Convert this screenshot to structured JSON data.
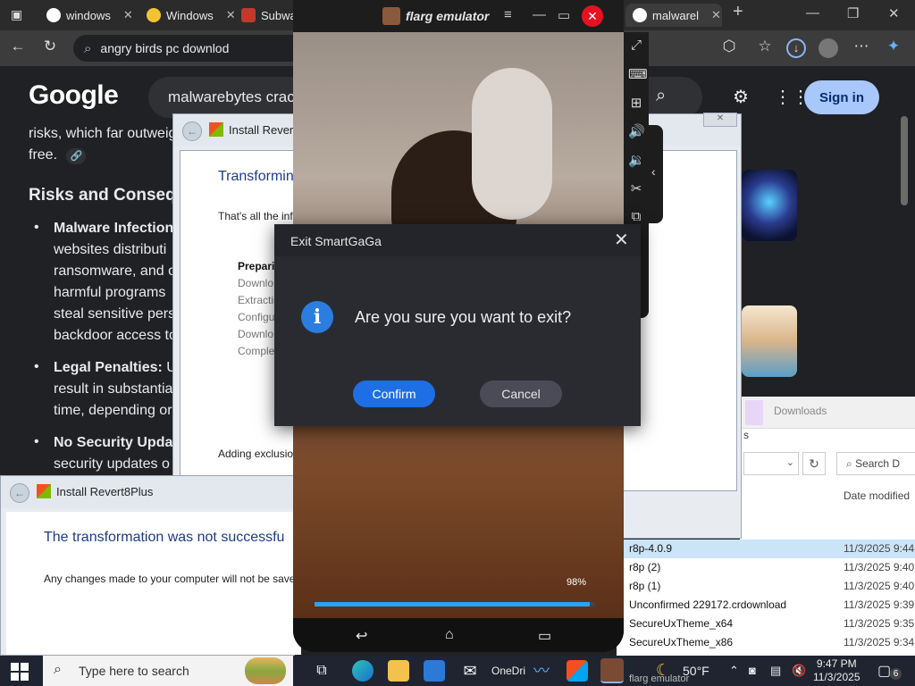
{
  "browser": {
    "tabs": [
      {
        "label": "windows"
      },
      {
        "label": "Windows"
      },
      {
        "label": "Subwa"
      },
      {
        "label": "malwarel"
      }
    ],
    "address": "angry birds pc downlod"
  },
  "google": {
    "logo": "Google",
    "query": "malwarebytes crack",
    "signin": "Sign in",
    "lines": {
      "l1": "risks, which far outweig",
      "l2": "free.",
      "heading": "Risks and Conseq",
      "b1_title": "Malware Infection:",
      "b1_l2": "websites distributi",
      "b1_l3": "ransomware, and o",
      "b1_l4": "harmful programs",
      "b1_l5": "steal sensitive pers",
      "b1_l6": "backdoor access to",
      "b2_title": "Legal Penalties:",
      "b2_title_rest": "Us",
      "b2_l2": "result in substantia",
      "b2_l3": "time, depending or",
      "b3_title": "No Security Updat",
      "b3_l2": "security updates o"
    }
  },
  "install_back": {
    "title": "Install Revert",
    "heading": "Transformin",
    "para": "That's all the inf",
    "steps": [
      "Preparir",
      "Downlo",
      "Extractir",
      "Configu",
      "Downlo",
      "Comple"
    ],
    "status": "Adding exclusio"
  },
  "install_front": {
    "title": "Install Revert8Plus",
    "heading": "The transformation was not successfu",
    "para": "Any changes made to your computer will not be save"
  },
  "emulator": {
    "name": "flarg emulator",
    "progress_label": "98%",
    "progress": 0.98
  },
  "dialog": {
    "title": "Exit SmartGaGa",
    "message": "Are you sure you want to exit?",
    "confirm": "Confirm",
    "cancel": "Cancel"
  },
  "downloads": {
    "title": "Downloads",
    "tab_suffix": "s",
    "search_placeholder": "Search D",
    "column": "Date modified",
    "files": [
      {
        "name": "r8p-4.0.9",
        "date": "11/3/2025 9:44"
      },
      {
        "name": "r8p (2)",
        "date": "11/3/2025 9:40"
      },
      {
        "name": "r8p (1)",
        "date": "11/3/2025 9:40"
      },
      {
        "name": "Unconfirmed 229172.crdownload",
        "date": "11/3/2025 9:39"
      },
      {
        "name": "SecureUxTheme_x64",
        "date": "11/3/2025 9:35"
      },
      {
        "name": "SecureUxTheme_x86",
        "date": "11/3/2025 9:34"
      }
    ]
  },
  "taskbar": {
    "search_placeholder": "Type here to search",
    "onedrive": "OneDri",
    "temp": "50°F",
    "time": "9:47 PM",
    "date": "11/3/2025",
    "notif_count": "6",
    "emu_item": "flarg emulator"
  },
  "colors": {
    "accent": "#1e6fe3",
    "close_red": "#e81123",
    "install_heading": "#1e3b8a"
  }
}
